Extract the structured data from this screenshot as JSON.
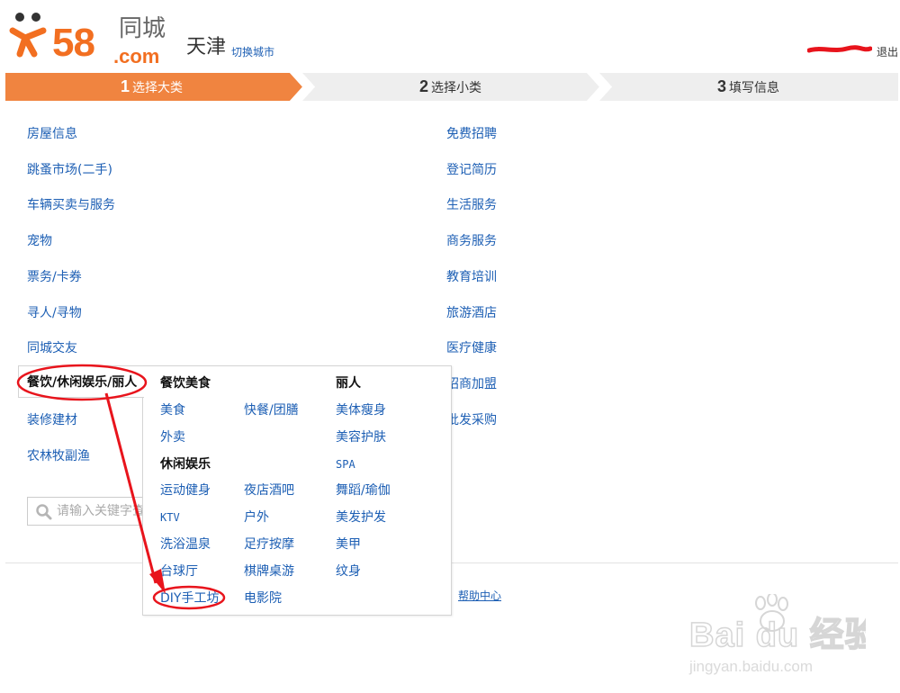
{
  "header": {
    "logo": {
      "number": "58",
      "dotcom": ".com",
      "tongcheng": "同城"
    },
    "city": "天津",
    "switch_city": "切换城市",
    "logout": "退出"
  },
  "steps": [
    {
      "num": "1",
      "label": "选择大类",
      "active": true
    },
    {
      "num": "2",
      "label": "选择小类",
      "active": false
    },
    {
      "num": "3",
      "label": "填写信息",
      "active": false
    }
  ],
  "categories_left": [
    "房屋信息",
    "跳蚤市场(二手)",
    "车辆买卖与服务",
    "宠物",
    "票务/卡券",
    "寻人/寻物",
    "同城交友",
    "餐饮/休闲娱乐/丽人",
    "装修建材",
    "农林牧副渔"
  ],
  "categories_right": [
    "免费招聘",
    "登记简历",
    "生活服务",
    "商务服务",
    "教育培训",
    "旅游酒店",
    "医疗健康",
    "招商加盟",
    "批发采购"
  ],
  "search": {
    "placeholder": "请输入关键字查"
  },
  "footer": {
    "help": "帮助中心"
  },
  "flyout": {
    "group_food": "餐饮美食",
    "group_beauty": "丽人",
    "group_leisure": "休闲娱乐",
    "food": [
      "美食",
      "快餐/团膳",
      "外卖"
    ],
    "beauty": [
      "美体瘦身",
      "美容护肤",
      "SPA",
      "舞蹈/瑜伽",
      "美发护发",
      "美甲",
      "纹身"
    ],
    "leisure": [
      "运动健身",
      "夜店酒吧",
      "KTV",
      "户外",
      "洗浴温泉",
      "足疗按摩",
      "台球厅",
      "棋牌桌游",
      "DIY手工坊",
      "电影院"
    ]
  },
  "watermark": {
    "brand": "Bai du 经验",
    "url": "jingyan.baidu.com"
  },
  "colors": {
    "accent": "#f08440",
    "link": "#1d5fb4",
    "annotation": "#e8141c",
    "step_inactive": "#eeeeee"
  }
}
